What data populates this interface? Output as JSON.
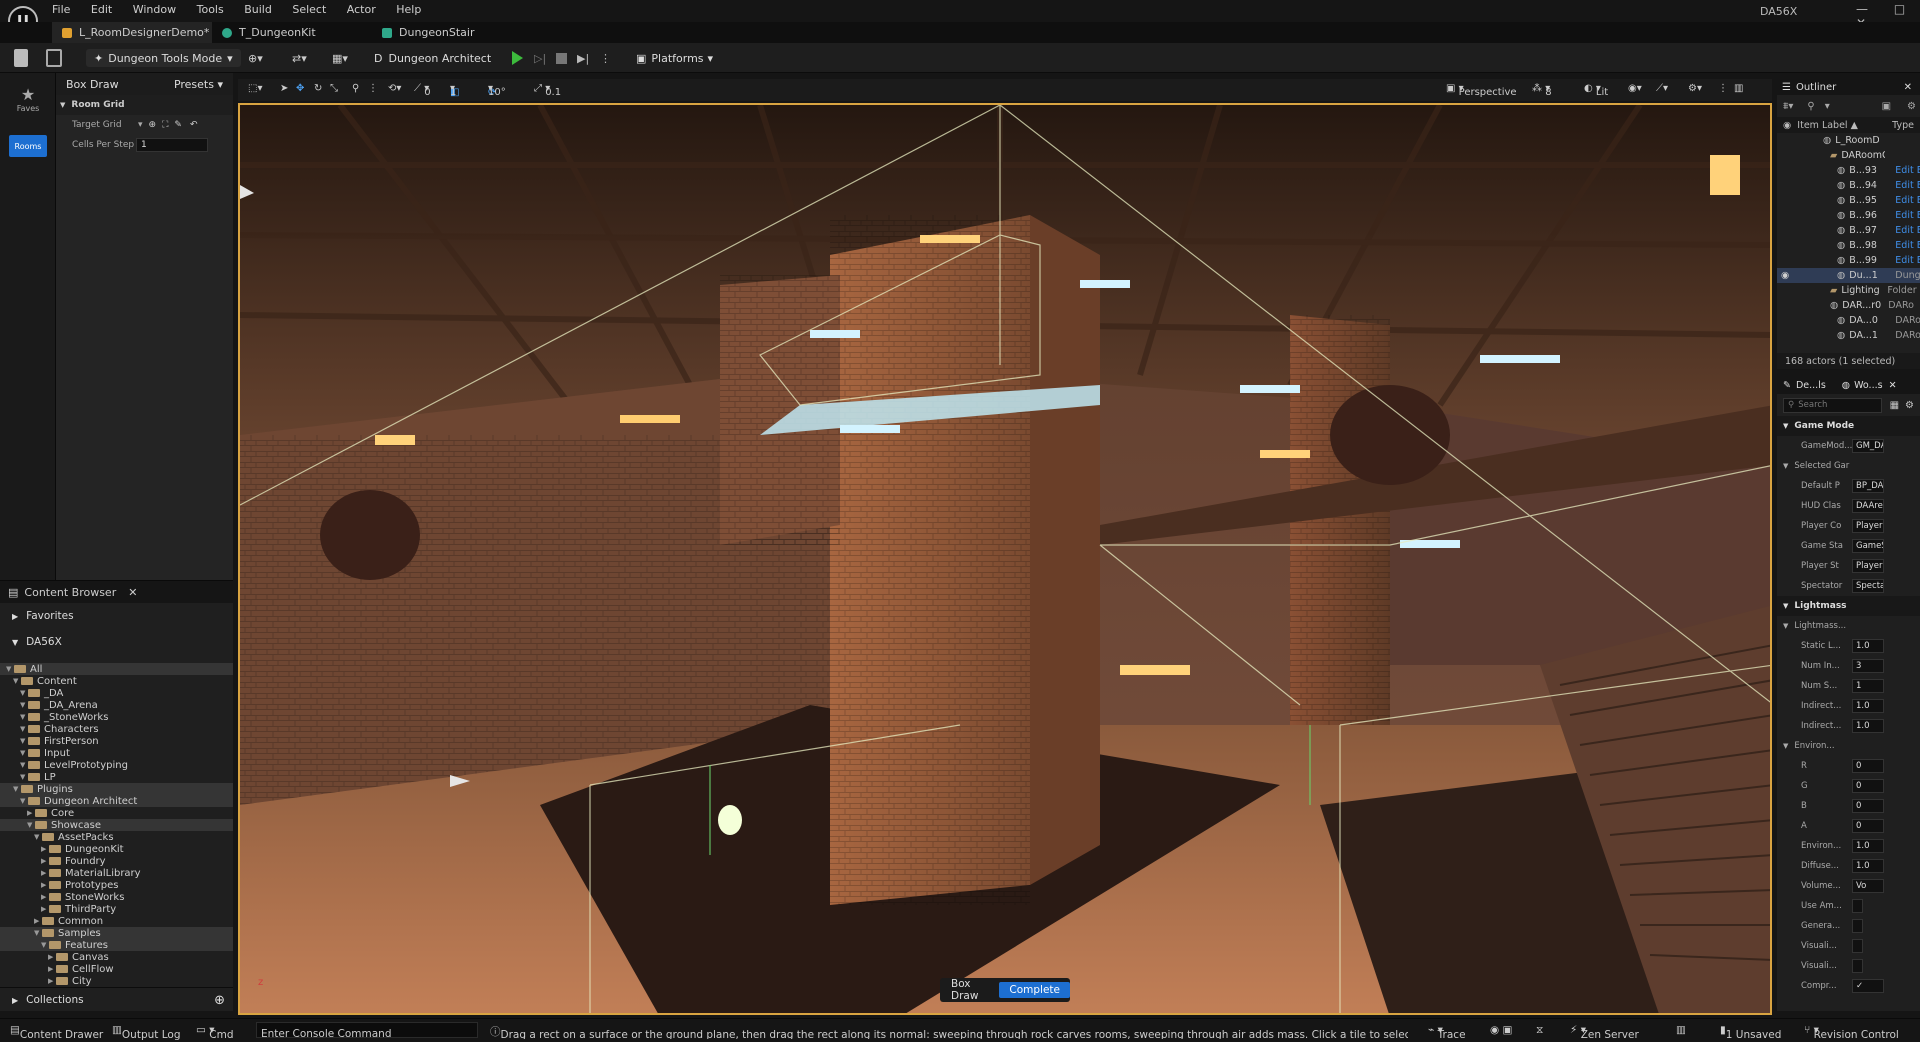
{
  "app": {
    "logo": "U",
    "project": "DA56X",
    "window_controls": [
      "—",
      "□",
      "✕"
    ]
  },
  "menu": [
    "File",
    "Edit",
    "Window",
    "Tools",
    "Build",
    "Select",
    "Actor",
    "Help"
  ],
  "tabs": [
    {
      "label": "L_RoomDesignerDemo*",
      "color": "#e0a030"
    },
    {
      "label": "T_DungeonKit",
      "color": "#2fa88a"
    },
    {
      "label": "DungeonStair",
      "color": "#2fa88a"
    }
  ],
  "toolbar": {
    "mode": "Dungeon Tools Mode",
    "dungeon_architect": "Dungeon Architect",
    "platforms": "Platforms"
  },
  "left_strip": {
    "faves": "Faves",
    "rooms": "Rooms"
  },
  "tool_panel": {
    "title": "Box Draw",
    "presets": "Presets",
    "section": "Room Grid",
    "target_grid_label": "Target Grid",
    "cells_per_step_label": "Cells Per Step",
    "cells_per_step_value": "1"
  },
  "content_browser": {
    "tab": "Content Browser",
    "favorites": "Favorites",
    "project": "DA56X",
    "collections": "Collections",
    "tree": [
      {
        "label": "All",
        "depth": 0,
        "sel": true
      },
      {
        "label": "Content",
        "depth": 1
      },
      {
        "label": "_DA",
        "depth": 2
      },
      {
        "label": "_DA_Arena",
        "depth": 2
      },
      {
        "label": "_StoneWorks",
        "depth": 2
      },
      {
        "label": "Characters",
        "depth": 2
      },
      {
        "label": "FirstPerson",
        "depth": 2
      },
      {
        "label": "Input",
        "depth": 2
      },
      {
        "label": "LevelPrototyping",
        "depth": 2
      },
      {
        "label": "LP",
        "depth": 2
      },
      {
        "label": "Plugins",
        "depth": 1,
        "sel": true
      },
      {
        "label": "Dungeon Architect",
        "depth": 2,
        "sel": true
      },
      {
        "label": "Core",
        "depth": 3
      },
      {
        "label": "Showcase",
        "depth": 3,
        "sel": true
      },
      {
        "label": "AssetPacks",
        "depth": 4
      },
      {
        "label": "DungeonKit",
        "depth": 5
      },
      {
        "label": "Foundry",
        "depth": 5
      },
      {
        "label": "MaterialLibrary",
        "depth": 5
      },
      {
        "label": "Prototypes",
        "depth": 5
      },
      {
        "label": "StoneWorks",
        "depth": 5
      },
      {
        "label": "ThirdParty",
        "depth": 5
      },
      {
        "label": "Common",
        "depth": 4
      },
      {
        "label": "Samples",
        "depth": 4,
        "sel": true
      },
      {
        "label": "Features",
        "depth": 5,
        "sel": true
      },
      {
        "label": "Canvas",
        "depth": 6
      },
      {
        "label": "CellFlow",
        "depth": 6
      },
      {
        "label": "City",
        "depth": 6
      }
    ]
  },
  "viewport_toolbar": {
    "snap_angle": "10°",
    "snap_scale": "0.1",
    "count_a": "0",
    "count_b": "1",
    "perspective": "Perspective",
    "cam_speed": "8",
    "lit": "Lit"
  },
  "box_draw_overlay": {
    "label": "Box Draw",
    "button": "Complete"
  },
  "outliner": {
    "title": "Outliner",
    "col_label": "Item Label ▲",
    "col_type": "Type",
    "count": "168 actors (1 selected)",
    "rows": [
      {
        "label": "L_RoomDesigner",
        "type": "",
        "indent": 4
      },
      {
        "label": "DARoomGridAc",
        "type": "",
        "indent": 5,
        "folder": true
      },
      {
        "label": "B...93",
        "type": "Edit E",
        "indent": 6
      },
      {
        "label": "B...94",
        "type": "Edit E",
        "indent": 6
      },
      {
        "label": "B...95",
        "type": "Edit E",
        "indent": 6
      },
      {
        "label": "B...96",
        "type": "Edit E",
        "indent": 6
      },
      {
        "label": "B...97",
        "type": "Edit E",
        "indent": 6
      },
      {
        "label": "B...98",
        "type": "Edit E",
        "indent": 6
      },
      {
        "label": "B...99",
        "type": "Edit E",
        "indent": 6
      },
      {
        "label": "Du...1",
        "type": "Dungeon",
        "indent": 6,
        "sel": true
      },
      {
        "label": "Lighting",
        "type": "Folder",
        "indent": 5,
        "folder": true
      },
      {
        "label": "DAR...r0",
        "type": "DARo",
        "indent": 5
      },
      {
        "label": "DA...0",
        "type": "DARo",
        "indent": 6
      },
      {
        "label": "DA...1",
        "type": "DARo",
        "indent": 6
      }
    ]
  },
  "details": {
    "tab1": "De...ls",
    "tab2": "Wo...s",
    "search_placeholder": "Search",
    "rows": [
      {
        "kind": "sec",
        "label": "Game Mode"
      },
      {
        "kind": "row",
        "label": "GameMod...",
        "value": "GM_DA_"
      },
      {
        "kind": "sub",
        "label": "Selected Gar"
      },
      {
        "kind": "row",
        "label": "Default P",
        "value": "BP_DA_A"
      },
      {
        "kind": "row",
        "label": "HUD Clas",
        "value": "DAArena"
      },
      {
        "kind": "row",
        "label": "Player Co",
        "value": "PlayerCo"
      },
      {
        "kind": "row",
        "label": "Game Sta",
        "value": "GameSta"
      },
      {
        "kind": "row",
        "label": "Player St",
        "value": "PlayerSt"
      },
      {
        "kind": "row",
        "label": "Spectator",
        "value": "Spectato"
      },
      {
        "kind": "sec",
        "label": "Lightmass"
      },
      {
        "kind": "sub",
        "label": "Lightmass..."
      },
      {
        "kind": "row",
        "label": "Static L...",
        "value": "1.0"
      },
      {
        "kind": "row",
        "label": "Num In...",
        "value": "3"
      },
      {
        "kind": "row",
        "label": "Num S...",
        "value": "1"
      },
      {
        "kind": "row",
        "label": "Indirect...",
        "value": "1.0"
      },
      {
        "kind": "row",
        "label": "Indirect...",
        "value": "1.0"
      },
      {
        "kind": "sub",
        "label": "Environ..."
      },
      {
        "kind": "row",
        "label": "R",
        "value": "0"
      },
      {
        "kind": "row",
        "label": "G",
        "value": "0"
      },
      {
        "kind": "row",
        "label": "B",
        "value": "0"
      },
      {
        "kind": "row",
        "label": "A",
        "value": "0"
      },
      {
        "kind": "row",
        "label": "Environ...",
        "value": "1.0"
      },
      {
        "kind": "row",
        "label": "Diffuse...",
        "value": "1.0"
      },
      {
        "kind": "row",
        "label": "Volume...",
        "value": "Vo"
      },
      {
        "kind": "row",
        "label": "Use Am...",
        "value": ""
      },
      {
        "kind": "row",
        "label": "Genera...",
        "value": ""
      },
      {
        "kind": "row",
        "label": "Visuali...",
        "value": ""
      },
      {
        "kind": "row",
        "label": "Visuali...",
        "value": ""
      },
      {
        "kind": "row",
        "label": "Compr...",
        "value": "✓"
      }
    ]
  },
  "status": {
    "content_drawer": "Content Drawer",
    "output_log": "Output Log",
    "cmd": "Cmd",
    "console_placeholder": "Enter Console Command",
    "hint": "Drag a rect on a surface or the ground plane, then drag the rect along its normal: sweeping through rock carves rooms, sweeping through air adds mass. Click a tile to select it, click the selection again to gr",
    "trace": "Trace",
    "zen": "Zen Server",
    "unsaved": "1 Unsaved",
    "revision": "Revision Control"
  }
}
